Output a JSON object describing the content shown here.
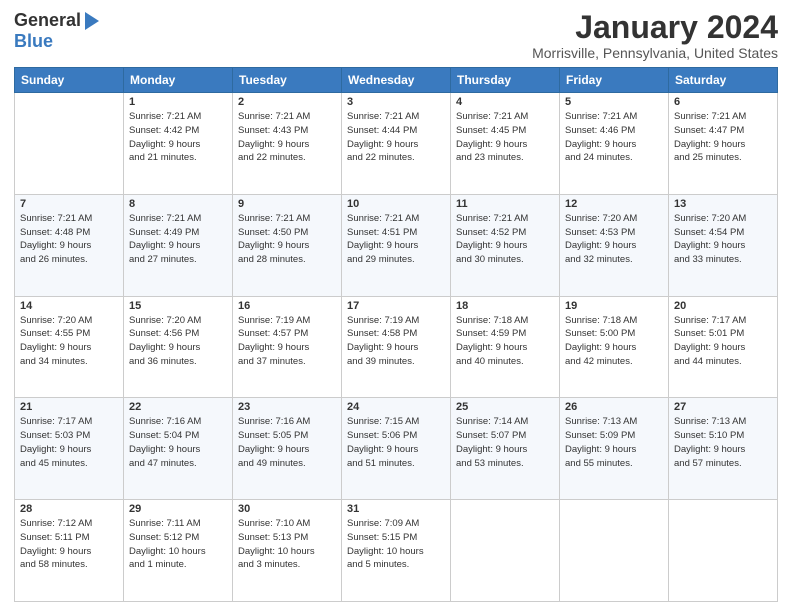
{
  "logo": {
    "general": "General",
    "blue": "Blue"
  },
  "header": {
    "title": "January 2024",
    "location": "Morrisville, Pennsylvania, United States"
  },
  "columns": [
    "Sunday",
    "Monday",
    "Tuesday",
    "Wednesday",
    "Thursday",
    "Friday",
    "Saturday"
  ],
  "weeks": [
    [
      {
        "day": "",
        "info": ""
      },
      {
        "day": "1",
        "info": "Sunrise: 7:21 AM\nSunset: 4:42 PM\nDaylight: 9 hours\nand 21 minutes."
      },
      {
        "day": "2",
        "info": "Sunrise: 7:21 AM\nSunset: 4:43 PM\nDaylight: 9 hours\nand 22 minutes."
      },
      {
        "day": "3",
        "info": "Sunrise: 7:21 AM\nSunset: 4:44 PM\nDaylight: 9 hours\nand 22 minutes."
      },
      {
        "day": "4",
        "info": "Sunrise: 7:21 AM\nSunset: 4:45 PM\nDaylight: 9 hours\nand 23 minutes."
      },
      {
        "day": "5",
        "info": "Sunrise: 7:21 AM\nSunset: 4:46 PM\nDaylight: 9 hours\nand 24 minutes."
      },
      {
        "day": "6",
        "info": "Sunrise: 7:21 AM\nSunset: 4:47 PM\nDaylight: 9 hours\nand 25 minutes."
      }
    ],
    [
      {
        "day": "7",
        "info": "Sunrise: 7:21 AM\nSunset: 4:48 PM\nDaylight: 9 hours\nand 26 minutes."
      },
      {
        "day": "8",
        "info": "Sunrise: 7:21 AM\nSunset: 4:49 PM\nDaylight: 9 hours\nand 27 minutes."
      },
      {
        "day": "9",
        "info": "Sunrise: 7:21 AM\nSunset: 4:50 PM\nDaylight: 9 hours\nand 28 minutes."
      },
      {
        "day": "10",
        "info": "Sunrise: 7:21 AM\nSunset: 4:51 PM\nDaylight: 9 hours\nand 29 minutes."
      },
      {
        "day": "11",
        "info": "Sunrise: 7:21 AM\nSunset: 4:52 PM\nDaylight: 9 hours\nand 30 minutes."
      },
      {
        "day": "12",
        "info": "Sunrise: 7:20 AM\nSunset: 4:53 PM\nDaylight: 9 hours\nand 32 minutes."
      },
      {
        "day": "13",
        "info": "Sunrise: 7:20 AM\nSunset: 4:54 PM\nDaylight: 9 hours\nand 33 minutes."
      }
    ],
    [
      {
        "day": "14",
        "info": "Sunrise: 7:20 AM\nSunset: 4:55 PM\nDaylight: 9 hours\nand 34 minutes."
      },
      {
        "day": "15",
        "info": "Sunrise: 7:20 AM\nSunset: 4:56 PM\nDaylight: 9 hours\nand 36 minutes."
      },
      {
        "day": "16",
        "info": "Sunrise: 7:19 AM\nSunset: 4:57 PM\nDaylight: 9 hours\nand 37 minutes."
      },
      {
        "day": "17",
        "info": "Sunrise: 7:19 AM\nSunset: 4:58 PM\nDaylight: 9 hours\nand 39 minutes."
      },
      {
        "day": "18",
        "info": "Sunrise: 7:18 AM\nSunset: 4:59 PM\nDaylight: 9 hours\nand 40 minutes."
      },
      {
        "day": "19",
        "info": "Sunrise: 7:18 AM\nSunset: 5:00 PM\nDaylight: 9 hours\nand 42 minutes."
      },
      {
        "day": "20",
        "info": "Sunrise: 7:17 AM\nSunset: 5:01 PM\nDaylight: 9 hours\nand 44 minutes."
      }
    ],
    [
      {
        "day": "21",
        "info": "Sunrise: 7:17 AM\nSunset: 5:03 PM\nDaylight: 9 hours\nand 45 minutes."
      },
      {
        "day": "22",
        "info": "Sunrise: 7:16 AM\nSunset: 5:04 PM\nDaylight: 9 hours\nand 47 minutes."
      },
      {
        "day": "23",
        "info": "Sunrise: 7:16 AM\nSunset: 5:05 PM\nDaylight: 9 hours\nand 49 minutes."
      },
      {
        "day": "24",
        "info": "Sunrise: 7:15 AM\nSunset: 5:06 PM\nDaylight: 9 hours\nand 51 minutes."
      },
      {
        "day": "25",
        "info": "Sunrise: 7:14 AM\nSunset: 5:07 PM\nDaylight: 9 hours\nand 53 minutes."
      },
      {
        "day": "26",
        "info": "Sunrise: 7:13 AM\nSunset: 5:09 PM\nDaylight: 9 hours\nand 55 minutes."
      },
      {
        "day": "27",
        "info": "Sunrise: 7:13 AM\nSunset: 5:10 PM\nDaylight: 9 hours\nand 57 minutes."
      }
    ],
    [
      {
        "day": "28",
        "info": "Sunrise: 7:12 AM\nSunset: 5:11 PM\nDaylight: 9 hours\nand 58 minutes."
      },
      {
        "day": "29",
        "info": "Sunrise: 7:11 AM\nSunset: 5:12 PM\nDaylight: 10 hours\nand 1 minute."
      },
      {
        "day": "30",
        "info": "Sunrise: 7:10 AM\nSunset: 5:13 PM\nDaylight: 10 hours\nand 3 minutes."
      },
      {
        "day": "31",
        "info": "Sunrise: 7:09 AM\nSunset: 5:15 PM\nDaylight: 10 hours\nand 5 minutes."
      },
      {
        "day": "",
        "info": ""
      },
      {
        "day": "",
        "info": ""
      },
      {
        "day": "",
        "info": ""
      }
    ]
  ]
}
